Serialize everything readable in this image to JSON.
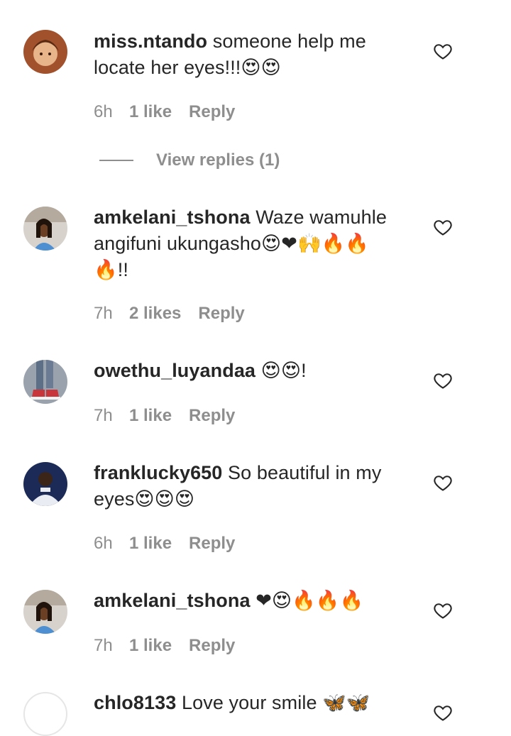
{
  "comments": [
    {
      "username": "miss.ntando",
      "text": "someone help me locate her eyes!!!😍😍",
      "time": "6h",
      "likes": "1 like",
      "reply": "Reply"
    },
    {
      "username": "amkelani_tshona",
      "text": "Waze wamuhle angifuni ukungasho😍❤🙌🔥🔥🔥!!",
      "time": "7h",
      "likes": "2 likes",
      "reply": "Reply"
    },
    {
      "username": "owethu_luyandaa",
      "text": "😍😍!",
      "time": "7h",
      "likes": "1 like",
      "reply": "Reply"
    },
    {
      "username": "franklucky650",
      "text": "So beautiful in my eyes😍😍😍",
      "time": "6h",
      "likes": "1 like",
      "reply": "Reply"
    },
    {
      "username": "amkelani_tshona",
      "text": "❤😍🔥🔥🔥",
      "time": "7h",
      "likes": "1 like",
      "reply": "Reply"
    },
    {
      "username": "chlo8133",
      "text": "Love your smile 🦋🦋"
    }
  ],
  "view_replies": "View replies (1)",
  "icons": {
    "like": "heart-outline-icon"
  },
  "colors": {
    "text": "#262626",
    "muted": "#8e8e8e"
  }
}
